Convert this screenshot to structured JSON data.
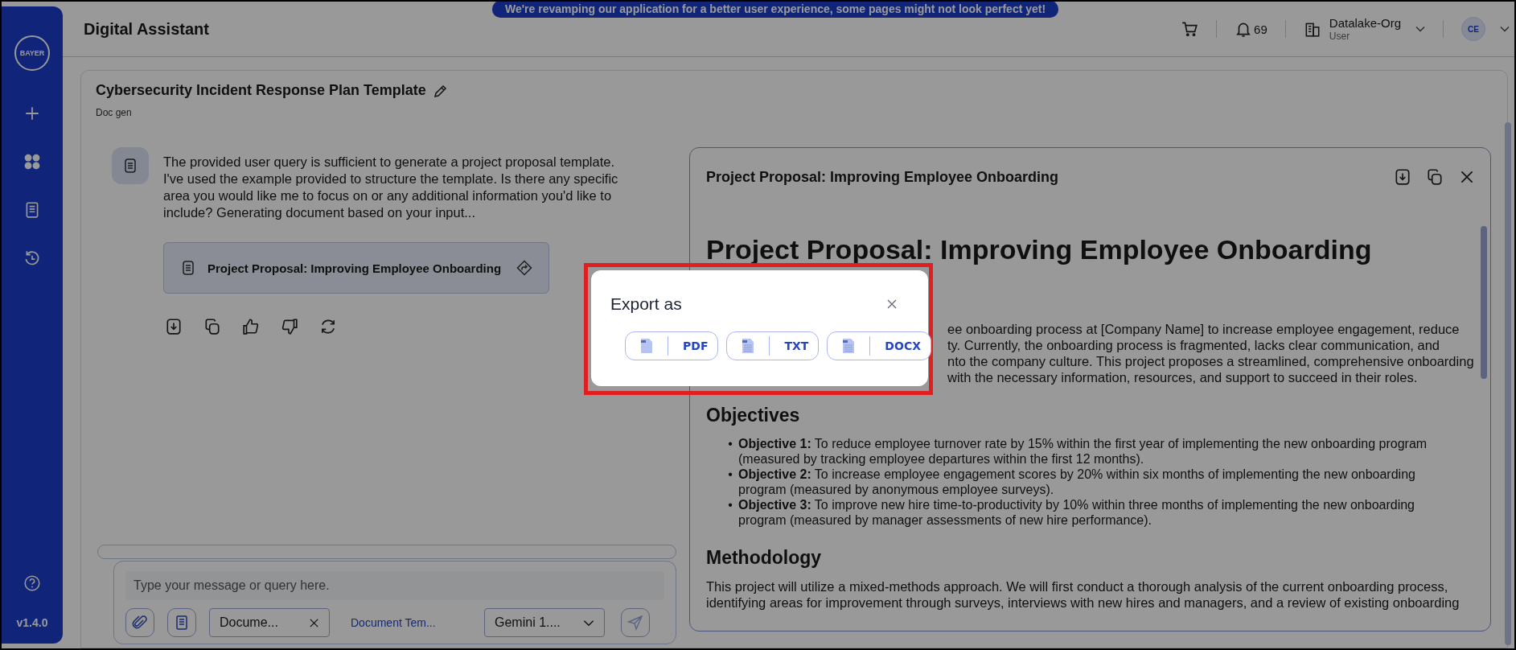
{
  "banner": {
    "text": "We're revamping our application for a better user experience, some pages might not look perfect yet!"
  },
  "sidebar": {
    "logo_text": "BAYER",
    "version": "v1.4.0"
  },
  "header": {
    "title": "Digital Assistant",
    "notification_count": "69",
    "org": {
      "name": "Datalake-Org",
      "role": "User"
    },
    "avatar_initials": "CE"
  },
  "page": {
    "title": "Cybersecurity Incident Response Plan Template",
    "subtitle": "Doc gen"
  },
  "chat": {
    "message": "The provided user query is sufficient to generate a project proposal template. I've used the example provided to structure the template. Is there any specific area you would like me to focus on or any additional information you'd like to include? Generating document based on your input...",
    "document_card": {
      "title": "Project Proposal: Improving Employee Onboarding"
    },
    "input": {
      "placeholder": "Type your message or query here.",
      "document_chip": "Docume...",
      "template_link": "Document Tem...",
      "model": "Gemini 1...."
    }
  },
  "document": {
    "title": "Project Proposal: Improving Employee Onboarding",
    "heading": "Project Proposal: Improving Employee Onboarding",
    "intro_fragments": [
      "ee onboarding process at [Company Name] to increase employee engagement, reduce",
      "ty. Currently, the onboarding process is fragmented, lacks clear communication, and",
      "nto the company culture. This project proposes a streamlined, comprehensive onboarding",
      "with the necessary information, resources, and support to succeed in their roles."
    ],
    "objectives": {
      "heading": "Objectives",
      "bullets": [
        {
          "marker": "•",
          "text": "**Objective 1:** To reduce employee turnover rate by 15% within the first year of implementing the new onboarding program (measured by tracking employee departures within the first 12 months)."
        },
        {
          "marker": "•",
          "text": "**Objective 2:** To increase employee engagement scores by 20% within six months of implementing the new onboarding program (measured by anonymous employee surveys)."
        },
        {
          "marker": "•",
          "text": "**Objective 3:** To improve new hire time-to-productivity by 10% within three months of implementing the new onboarding program (measured by manager assessments of new hire performance)."
        }
      ]
    },
    "methodology": {
      "heading": "Methodology",
      "paragraph": "This project will utilize a mixed-methods approach. We will first conduct a thorough analysis of the current onboarding process, identifying areas for improvement through surveys, interviews with new hires and managers, and a review of existing onboarding"
    }
  },
  "modal": {
    "title": "Export as",
    "options": [
      {
        "label": "PDF",
        "kind": "pdf"
      },
      {
        "label": "TXT",
        "kind": "txt"
      },
      {
        "label": "DOCX",
        "kind": "docx"
      }
    ]
  }
}
